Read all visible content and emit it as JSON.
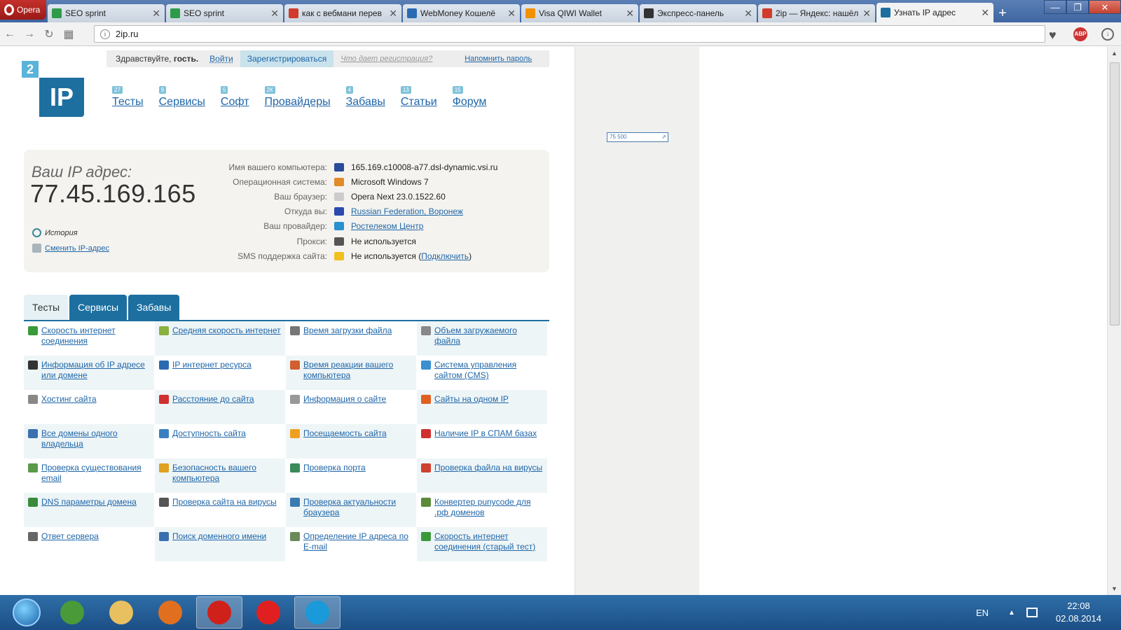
{
  "browser": {
    "opera_label": "Opera",
    "tabs": [
      {
        "label": "SEO sprint",
        "icon": "seosprint-icon",
        "color": "#2d9b4a"
      },
      {
        "label": "SEO sprint",
        "icon": "seosprint-icon",
        "color": "#2d9b4a"
      },
      {
        "label": "как с вебмани перев",
        "icon": "yandex-icon",
        "color": "#d03b2b"
      },
      {
        "label": "WebMoney Кошелё",
        "icon": "webmoney-icon",
        "color": "#2a6ab3"
      },
      {
        "label": "Visa QIWI Wallet",
        "icon": "qiwi-icon",
        "color": "#f39200"
      },
      {
        "label": "Экспресс-панель",
        "icon": "speeddial-icon",
        "color": "#333333"
      },
      {
        "label": "2ip — Яндекс: нашёл",
        "icon": "yandex-icon",
        "color": "#d03b2b"
      },
      {
        "label": "Узнать IP адрес",
        "icon": "2ip-icon",
        "color": "#1d6fa0"
      }
    ],
    "new_tab": "+",
    "url": "2ip.ru",
    "abp_label": "ABP"
  },
  "login_bar": {
    "greeting": "Здравствуйте,",
    "guest": "гость.",
    "login": "Войти",
    "register": "Зарегистрироваться",
    "what_gives": "Что дает регистрация?",
    "remind": "Напомнить пароль"
  },
  "logo": {
    "small": "2",
    "big": "IP"
  },
  "nav": [
    {
      "label": "Тесты",
      "count": "27"
    },
    {
      "label": "Сервисы",
      "count": "9"
    },
    {
      "label": "Софт",
      "count": "5"
    },
    {
      "label": "Провайдеры",
      "count": "2К"
    },
    {
      "label": "Забавы",
      "count": "4"
    },
    {
      "label": "Статьи",
      "count": "13"
    },
    {
      "label": "Форум",
      "count": "15"
    }
  ],
  "counter_label": "75 500",
  "ip_panel": {
    "label": "Ваш IP адрес:",
    "ip": "77.45.169.165",
    "history": "История",
    "change_ip": "Сменить IP-адрес",
    "rows": [
      {
        "key": "Имя вашего компьютера:",
        "value": "165.169.c10008-a77.dsl-dynamic.vsi.ru",
        "link": false,
        "icon_color": "#2a4a9a"
      },
      {
        "key": "Операционная система:",
        "value": "Microsoft Windows 7",
        "link": false,
        "icon_color": "#e08a2a"
      },
      {
        "key": "Ваш браузер:",
        "value": "Opera Next 23.0.1522.60",
        "link": false,
        "icon_color": "#cccccc"
      },
      {
        "key": "Откуда вы:",
        "value": "Russian Federation, Воронеж",
        "link": true,
        "icon_color": "#2a4ab0"
      },
      {
        "key": "Ваш провайдер:",
        "value": "Ростелеком Центр",
        "link": true,
        "icon_color": "#2a90d0"
      },
      {
        "key": "Прокси:",
        "value": "Не используется",
        "link": false,
        "icon_color": "#555555"
      },
      {
        "key": "SMS поддержка сайта:",
        "value": "Не используется (",
        "link_text": "Подключить",
        "suffix": ")",
        "link": false,
        "icon_color": "#f0c020"
      }
    ]
  },
  "tabs": [
    {
      "label": "Тесты",
      "selected": true
    },
    {
      "label": "Сервисы",
      "selected": false
    },
    {
      "label": "Забавы",
      "selected": false
    }
  ],
  "services": [
    {
      "label": "Скорость интернет соединения",
      "icon_color": "#3a9a3a"
    },
    {
      "label": "Средняя скорость интернет",
      "icon_color": "#8ab040"
    },
    {
      "label": "Время загрузки файла",
      "icon_color": "#777777"
    },
    {
      "label": "Объем загружаемого файла",
      "icon_color": "#888888"
    },
    {
      "label": "Информация об IP адресе или домене",
      "icon_color": "#333333"
    },
    {
      "label": "IP интернет ресурса",
      "icon_color": "#2a6ab3"
    },
    {
      "label": "Время реакции вашего компьютера",
      "icon_color": "#d06030"
    },
    {
      "label": "Система управления сайтом (CMS)",
      "icon_color": "#3a90d0"
    },
    {
      "label": "Хостинг сайта",
      "icon_color": "#888888"
    },
    {
      "label": "Расстояние до сайта",
      "icon_color": "#d03030"
    },
    {
      "label": "Информация о сайте",
      "icon_color": "#999999"
    },
    {
      "label": "Сайты на одном IP",
      "icon_color": "#e06020"
    },
    {
      "label": "Все домены одного владельца",
      "icon_color": "#3a70b0"
    },
    {
      "label": "Доступность сайта",
      "icon_color": "#3a80c0"
    },
    {
      "label": "Посещаемость сайта",
      "icon_color": "#f0a020"
    },
    {
      "label": "Наличие IP в СПАМ базах",
      "icon_color": "#d03030"
    },
    {
      "label": "Проверка существования email",
      "icon_color": "#5a9a4a"
    },
    {
      "label": "Безопасность вашего компьютера",
      "icon_color": "#e0a020"
    },
    {
      "label": "Проверка порта",
      "icon_color": "#3a8a5a"
    },
    {
      "label": "Проверка файла на вирусы",
      "icon_color": "#d04030"
    },
    {
      "label": "DNS параметры домена",
      "icon_color": "#3a8a3a"
    },
    {
      "label": "Проверка сайта на вирусы",
      "icon_color": "#555555"
    },
    {
      "label": "Проверка актуальности браузера",
      "icon_color": "#3a7ab0"
    },
    {
      "label": "Конвертер punycode для .рф доменов",
      "icon_color": "#5a8a3a"
    },
    {
      "label": "Ответ сервера",
      "icon_color": "#666666"
    },
    {
      "label": "Поиск доменного имени",
      "icon_color": "#3a70b0"
    },
    {
      "label": "Определение IP адреса по E-mail",
      "icon_color": "#6a8a5a"
    },
    {
      "label": "Скорость интернет соединения (старый тест)",
      "icon_color": "#3a9a3a"
    }
  ],
  "taskbar": {
    "apps": [
      {
        "name": "chrome",
        "color": "#4a9a3a",
        "pressed": false
      },
      {
        "name": "explorer",
        "color": "#e8c060",
        "pressed": false
      },
      {
        "name": "media-player",
        "color": "#e07020",
        "pressed": false
      },
      {
        "name": "opera",
        "color": "#d0201a",
        "pressed": true
      },
      {
        "name": "yandex",
        "color": "#e02020",
        "pressed": false
      },
      {
        "name": "skype",
        "color": "#1a9ad8",
        "pressed": true
      }
    ],
    "lang": "EN",
    "time": "22:08",
    "date": "02.08.2014"
  }
}
